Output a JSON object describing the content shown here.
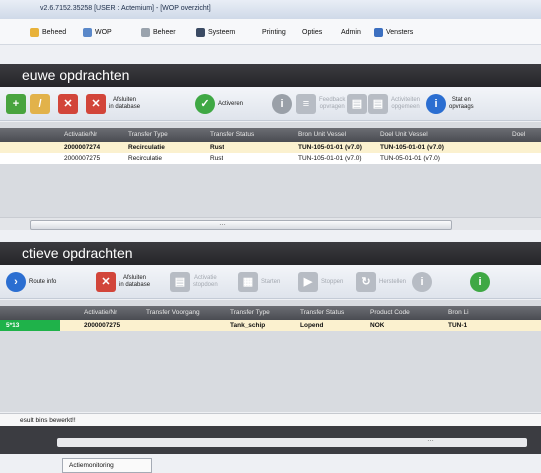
{
  "window": {
    "title": "v2.6.7152.35258 [USER : Actemium] - [WOP overzicht]"
  },
  "menu": [
    {
      "label": "Beheed",
      "icon": "folder-icon",
      "color": "#e8b23a"
    },
    {
      "label": "WOP",
      "icon": "network-icon",
      "color": "#5a88c9"
    },
    {
      "label": "Beheer",
      "icon": "gear-icon",
      "color": "#9aa3ad"
    },
    {
      "label": "Systeem",
      "icon": "grid-icon",
      "color": "#3a4a63"
    },
    {
      "label": "Printing",
      "icon": "",
      "color": ""
    },
    {
      "label": "Opties",
      "icon": "",
      "color": ""
    },
    {
      "label": "Admin",
      "icon": "",
      "color": ""
    },
    {
      "label": "Vensters",
      "icon": "window-icon",
      "color": "#3c6fc0"
    }
  ],
  "new_orders": {
    "title": "euwe opdrachten",
    "toolbar": [
      {
        "label": "",
        "icon": "add-icon",
        "color": "#49a43f",
        "enabled": true
      },
      {
        "label": "",
        "icon": "edit-icon",
        "color": "#e2b24a",
        "enabled": true
      },
      {
        "label": "",
        "icon": "delete-icon",
        "color": "#d2453a",
        "enabled": true
      },
      {
        "label": "Afsluiten\nin database",
        "icon": "close-database-icon",
        "color": "#d2453a",
        "enabled": true
      },
      {
        "label": "Activeren",
        "icon": "activate-icon",
        "color": "#3fa844",
        "enabled": true
      },
      {
        "label": "",
        "icon": "info-icon",
        "color": "#9aa0a8",
        "enabled": false
      },
      {
        "label": "Feedback\nopvragen",
        "icon": "feedback-icon",
        "color": "#b7bcc4",
        "enabled": false
      },
      {
        "label": "",
        "icon": "doc-icon",
        "color": "#b7bcc4",
        "enabled": false
      },
      {
        "label": "Activiteiten\nopgemeen",
        "icon": "activities-icon",
        "color": "#b7bcc4",
        "enabled": false
      },
      {
        "label": "Stat en\nopvraags",
        "icon": "info-icon",
        "color": "#2b6ed1",
        "enabled": true
      }
    ],
    "columns": [
      "",
      "Activatie/Nr",
      "Transfer Type",
      "Transfer Status",
      "Bron Unit Vessel",
      "Doel Unit Vessel",
      "Doel"
    ],
    "rows": [
      {
        "cells": [
          "",
          "2000007274",
          "Recirculatie",
          "Rust",
          "TUN-105-01-01 (v7.0)",
          "TUN-105-01-01 (v7.0)",
          ""
        ],
        "selected": true
      },
      {
        "cells": [
          "",
          "2000007275",
          "Recirculatie",
          "Rust",
          "TUN-105-01-01 (v7.0)",
          "TUN-05-01-01 (v7.0)",
          ""
        ],
        "selected": false
      }
    ]
  },
  "active_orders": {
    "title": "ctieve opdrachten",
    "toolbar": [
      {
        "label": "Route info",
        "icon": "route-icon",
        "color": "#2b6ed1",
        "enabled": true
      },
      {
        "label": "Afsluiten\nin database",
        "icon": "close-database-icon",
        "color": "#d2453a",
        "enabled": true
      },
      {
        "label": "Activatie\nstopdoen",
        "icon": "doc-icon",
        "color": "#b7bcc4",
        "enabled": false
      },
      {
        "label": "Starten",
        "icon": "grid-icon",
        "color": "#b7bcc4",
        "enabled": false
      },
      {
        "label": "Stoppen",
        "icon": "play-icon",
        "color": "#b7bcc4",
        "enabled": false
      },
      {
        "label": "Herstellen",
        "icon": "refresh-icon",
        "color": "#b7bcc4",
        "enabled": false
      },
      {
        "label": "",
        "icon": "info-icon",
        "color": "#b7bcc4",
        "enabled": false
      },
      {
        "label": "",
        "icon": "info-icon",
        "color": "#3fa844",
        "enabled": true
      }
    ],
    "columns": [
      "",
      "Activatie/Nr",
      "Transfer Voorgang",
      "Transfer Type",
      "Transfer Status",
      "Product Code",
      "Bron Li"
    ],
    "rows": [
      {
        "cells": [
          "5*13",
          "2000007275",
          "",
          "Tank_schip",
          "Lopend",
          "NOK",
          "TUN-1"
        ],
        "selected": true,
        "status_color": "#1fb24a"
      }
    ]
  },
  "status": {
    "text": "esult bins bewerkt!!"
  },
  "bottom_tab": {
    "label": "Actiemonitoring"
  }
}
